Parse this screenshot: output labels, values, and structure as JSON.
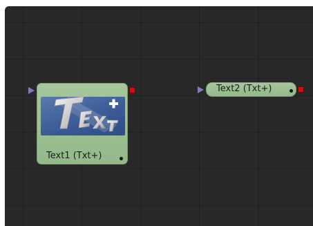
{
  "flow": {
    "nodes": [
      {
        "label": "Text1  (Txt+)",
        "icon": "text-plus-tool-icon",
        "selected": true
      },
      {
        "label": "Text2  (Txt+)",
        "icon": null,
        "selected": false
      }
    ]
  },
  "colors": {
    "canvas": "#282828",
    "grid": "#202020",
    "node_fill": "#9dc193",
    "input_port": "#7c7cc8",
    "output_port": "#d01010",
    "thumbnail": "#3f5e99"
  }
}
